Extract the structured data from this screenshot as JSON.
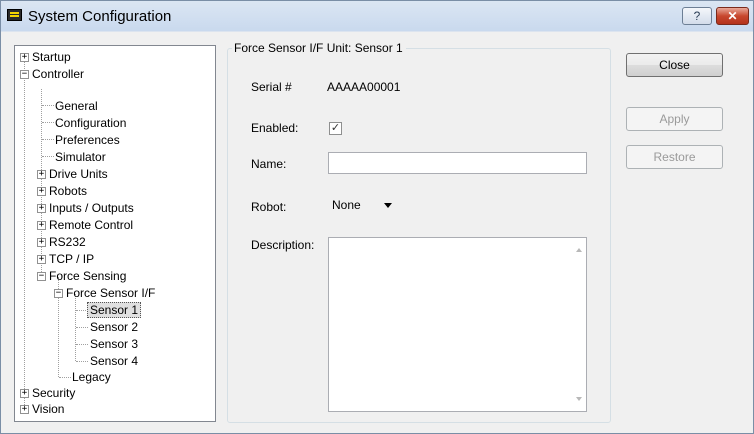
{
  "window": {
    "title": "System Configuration",
    "help_label": "?",
    "close_label": "✕"
  },
  "tree": {
    "items": [
      {
        "label": "Startup",
        "expander": "+"
      },
      {
        "label": "Controller",
        "expander": "−"
      },
      {
        "label": "General"
      },
      {
        "label": "Configuration"
      },
      {
        "label": "Preferences"
      },
      {
        "label": "Simulator"
      },
      {
        "label": "Drive Units",
        "expander": "+"
      },
      {
        "label": "Robots",
        "expander": "+"
      },
      {
        "label": "Inputs / Outputs",
        "expander": "+"
      },
      {
        "label": "Remote Control",
        "expander": "+"
      },
      {
        "label": "RS232",
        "expander": "+"
      },
      {
        "label": "TCP / IP",
        "expander": "+"
      },
      {
        "label": "Force Sensing",
        "expander": "−"
      },
      {
        "label": "Force Sensor I/F",
        "expander": "−"
      },
      {
        "label": "Sensor 1",
        "selected": true
      },
      {
        "label": "Sensor 2"
      },
      {
        "label": "Sensor 3"
      },
      {
        "label": "Sensor 4"
      },
      {
        "label": "Legacy"
      },
      {
        "label": "Security",
        "expander": "+"
      },
      {
        "label": "Vision",
        "expander": "+"
      }
    ]
  },
  "panel": {
    "group_title": "Force Sensor I/F Unit: Sensor 1",
    "serial_label": "Serial #",
    "serial_value": "AAAAA00001",
    "enabled_label": "Enabled:",
    "enabled_checked": true,
    "enabled_mark": "✓",
    "name_label": "Name:",
    "name_value": "",
    "robot_label": "Robot:",
    "robot_value": "None",
    "description_label": "Description:",
    "description_value": ""
  },
  "buttons": {
    "close": "Close",
    "apply": "Apply",
    "restore": "Restore"
  }
}
